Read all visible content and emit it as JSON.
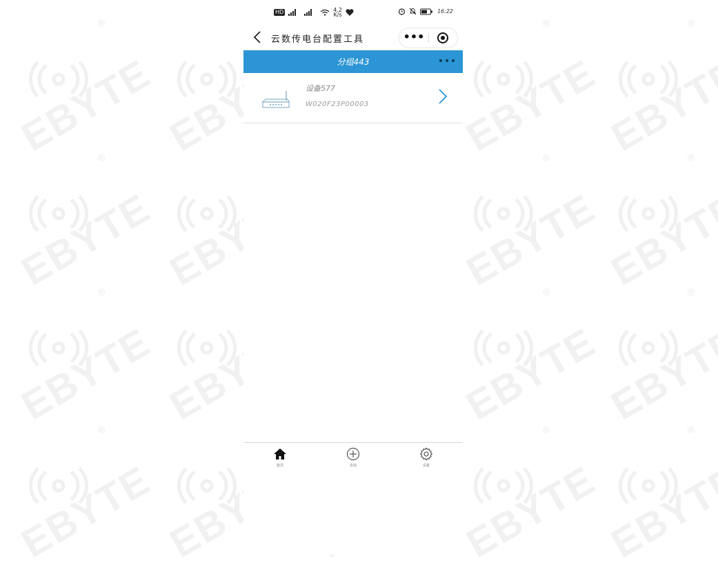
{
  "status_bar": {
    "hd_badge": "HD",
    "net_speed_value": "4.2",
    "net_speed_unit": "K/s",
    "time": "16:22"
  },
  "header": {
    "title": "云数传电台配置工具",
    "back_icon": "chevron-left-icon",
    "capsule": {
      "more_icon": "dots-icon",
      "close_icon": "target-icon"
    }
  },
  "group": {
    "title": "分组443"
  },
  "devices": [
    {
      "name": "设备577",
      "serial": "W020F23P00003",
      "icon": "router-icon"
    }
  ],
  "tabbar": {
    "items": [
      {
        "label": "首页",
        "icon": "home-icon"
      },
      {
        "label": "添加",
        "icon": "add-circle-icon"
      },
      {
        "label": "设置",
        "icon": "gear-icon"
      }
    ]
  },
  "watermark": {
    "text": "EBYTE",
    "mark": "®"
  },
  "colors": {
    "accent": "#2b95d5",
    "chevron": "#2b95d5"
  }
}
